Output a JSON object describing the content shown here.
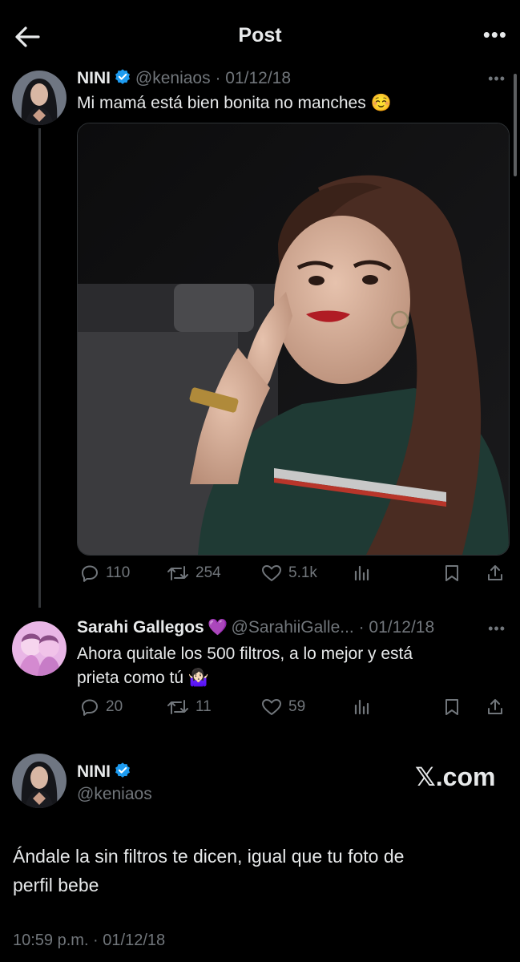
{
  "header": {
    "title": "Post"
  },
  "original_post": {
    "author_name": "NINI",
    "handle_date": "@keniaos · 01/12/18",
    "text": "Mi mamá está bien bonita no manches ☺️",
    "stats": {
      "replies": "110",
      "reposts": "254",
      "likes": "5.1k"
    }
  },
  "reply": {
    "author_name": "Sarahi Gallegos",
    "emoji": "💜",
    "handle_date": "@SarahiiGalle... · 01/12/18",
    "text_line1": "Ahora quitale los 500 filtros, a lo mejor y está",
    "text_line2": "prieta como tú 🤷🏻‍♀️",
    "stats": {
      "replies": "20",
      "reposts": "11",
      "likes": "59"
    }
  },
  "main_post": {
    "author_name": "NINI",
    "handle": "@keniaos",
    "text_line1": "Ándale la sin filtros te dicen, igual que tu foto de",
    "text_line2": "perfil bebe",
    "timestamp": "10:59 p.m. · 01/12/18"
  },
  "watermark": "𝕏.com",
  "colors": {
    "background": "#000000",
    "text": "#e7e9ea",
    "muted": "#71767b",
    "verified": "#1d9bf0",
    "thread_line": "#333639"
  }
}
